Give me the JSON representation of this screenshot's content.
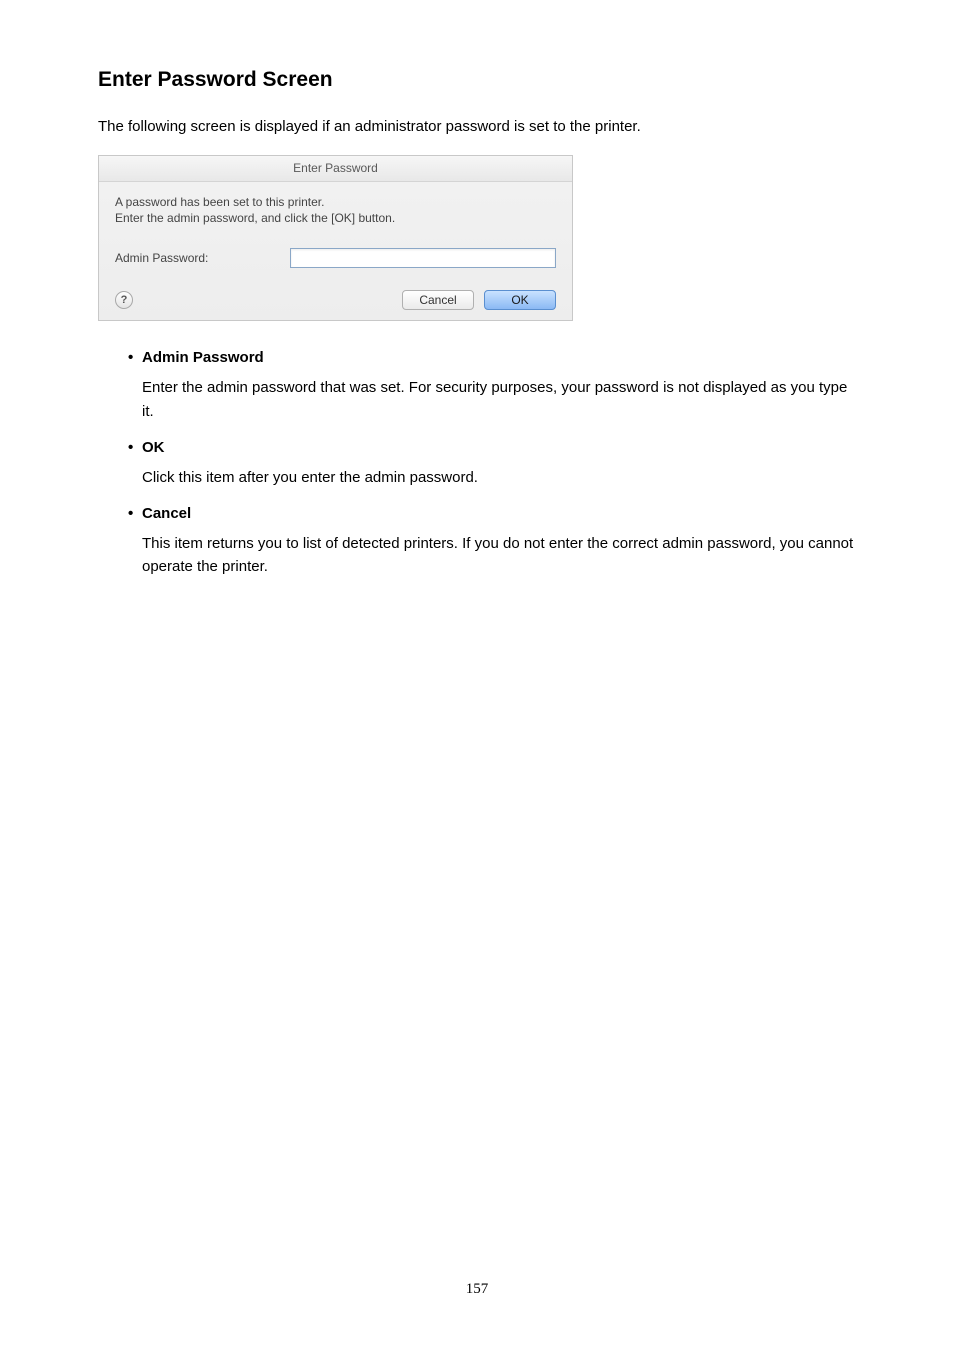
{
  "heading": "Enter Password Screen",
  "intro": "The following screen is displayed if an administrator password is set to the printer.",
  "dialog": {
    "title": "Enter Password",
    "message_line1": "A password has been set to this printer.",
    "message_line2": "Enter the admin password, and click the [OK] button.",
    "field_label": "Admin Password:",
    "help_glyph": "?",
    "cancel": "Cancel",
    "ok": "OK"
  },
  "items": [
    {
      "label": "Admin Password",
      "body": "Enter the admin password that was set. For security purposes, your password is not displayed as you type it."
    },
    {
      "label": "OK",
      "body": "Click this item after you enter the admin password."
    },
    {
      "label": "Cancel",
      "body": "This item returns you to list of detected printers. If you do not enter the correct admin password, you cannot operate the printer."
    }
  ],
  "page_number": "157"
}
